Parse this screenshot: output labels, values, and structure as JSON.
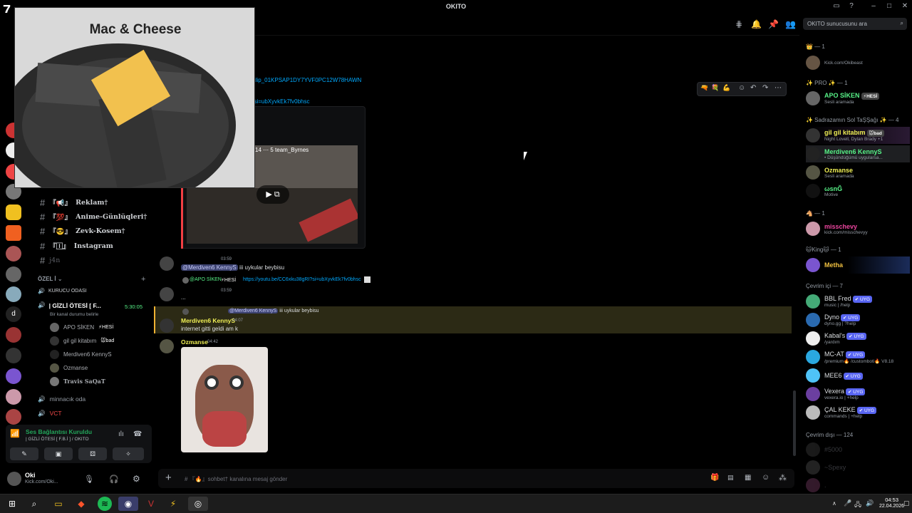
{
  "window": {
    "title": "OKITO",
    "corner_label": "7"
  },
  "header": {
    "search_placeholder": "OKITO sunucusunu ara"
  },
  "video_overlay": {
    "caption": "Mac & Cheese"
  },
  "channels": {
    "items": [
      {
        "label": "Reklam†",
        "prefix": "『📢』"
      },
      {
        "label": "Anime-Günlüqleri†",
        "prefix": "『💯』"
      },
      {
        "label": "Zevk-Kosem†",
        "prefix": "『😎』"
      },
      {
        "label": "Instagram",
        "prefix": "『🄸』"
      },
      {
        "label": "j4n",
        "prefix": ""
      }
    ],
    "category": "ÖZEL İ",
    "voice_channels": [
      {
        "label": "KURUCU ODASI"
      },
      {
        "label": "| GİZLİ ÖTESİ [ F...",
        "timer": "5:30:05",
        "status": "Bir kanal durumu belirle"
      }
    ],
    "voice_members": [
      "APO SİKEN",
      "gil gil kitabım",
      "Merdiven6 KennyS",
      "Ozmanse",
      "Travis SaQaT"
    ],
    "voice_member_tags": [
      "⚡HESİ",
      "🐭bad"
    ],
    "extra_channels": [
      "minnacık oda",
      "VCT"
    ]
  },
  "voice_panel": {
    "status": "Ses Bağlantısı Kuruldu",
    "channel": "| GİZLİ ÖTESİ [ F.B.İ ] / OKITO"
  },
  "user_panel": {
    "name": "Oki",
    "status": "Kick.com/Oki..."
  },
  "messages": {
    "clip_link": "ps/clip_01KPSAP1DY7YVF0PC12W78HAWN",
    "yt_link": "RI?si=ubXyvkEk7fv0bhsc",
    "embed_overlay": "14 ⋯ 5  team_Byrnes",
    "msg1": {
      "time": "03:59",
      "mention": "@Merdiven6 KennyS",
      "text": "iii uykular beybisu"
    },
    "msg2": {
      "reply_author": "@APO SİKEN",
      "reply_tag": "⚡HESİ",
      "reply_link": "https://youtu.be/CC6xku38gRI?si=ubXyvkEk7fv0bhsc",
      "time": "03:59",
      "text": "..."
    },
    "msg3": {
      "reply_mention": "@Merdiven6 KennyS",
      "reply_text": "iii uykular beybisu",
      "author": "Merdiven6 KennyS",
      "time": "04:07",
      "text": "internet gitti geldi am k"
    },
    "msg4": {
      "author": "Ozmanse",
      "time": "04:42"
    }
  },
  "composer": {
    "placeholder": "# 『🔥』sohbet† kanalına mesaj gönder"
  },
  "members": {
    "groups": [
      {
        "header": "👑 — 1",
        "members": [
          {
            "name": "",
            "sub": "Kick.com/Okibeast",
            "color": "#dbdee1"
          }
        ]
      },
      {
        "header": "✨ PRO ✨ — 1",
        "members": [
          {
            "name": "APO SİKEN",
            "tag": "⚡HESİ",
            "sub": "Sesli aramada",
            "color": "#57f287"
          }
        ]
      },
      {
        "header": "✨ Sadrazamın Sol TaŞŞağı ✨ — 4",
        "members": [
          {
            "name": "gil gil kitabım",
            "tag": "🐭bad",
            "sub": "Night Lovell, Dylan Brady +1",
            "color": "#f0f055"
          },
          {
            "name": "Merdiven6 KennyS",
            "sub": "• Düşündüğümü uygularsa...",
            "color": "#f0f055"
          },
          {
            "name": "Ozmanse",
            "sub": "Sesli aramada",
            "color": "#f0f055"
          },
          {
            "name": "ωsnĞ",
            "sub": "Motive",
            "color": "#f0f055"
          }
        ]
      },
      {
        "header": "🐴 — 1",
        "members": [
          {
            "name": "misschevy",
            "sub": "kick.com/misschevyy",
            "color": "#eb459e"
          }
        ]
      },
      {
        "header": "🐱King🐱 — 1",
        "members": [
          {
            "name": "Metha",
            "sub": "",
            "color": "#f0c040"
          }
        ]
      },
      {
        "header": "Çevrim içi — 7",
        "members": [
          {
            "name": "BBL Fred",
            "tag": "✔ UYG",
            "sub": "music | /help",
            "color": "#dbdee1"
          },
          {
            "name": "Dyno",
            "tag": "✔ UYG",
            "sub": "dyno.gg | ?help",
            "color": "#dbdee1"
          },
          {
            "name": "Kabal's",
            "tag": "✔ UYG",
            "sub": "/yardım",
            "color": "#dbdee1"
          },
          {
            "name": "MC-AT",
            "tag": "✔ UYG",
            "sub": "/premium🔥 /customboti🔥 V8.18",
            "color": "#dbdee1"
          },
          {
            "name": "MEE6",
            "tag": "✔ UYG",
            "sub": "",
            "color": "#dbdee1"
          },
          {
            "name": "Vexera",
            "tag": "✔ UYG",
            "sub": "vexera.io | +help",
            "color": "#dbdee1"
          },
          {
            "name": "ÇAL KEKE",
            "tag": "✔ UYG",
            "sub": "commands | +help",
            "color": "#dbdee1"
          }
        ]
      },
      {
        "header": "Çevrim dışı — 124",
        "members": [
          {
            "name": "#5000",
            "sub": "",
            "color": "#4e5058"
          },
          {
            "name": "~Spexy",
            "sub": "",
            "color": "#4e5058"
          },
          {
            "name": ".",
            "sub": "",
            "color": "#4e5058"
          }
        ]
      }
    ]
  },
  "taskbar": {
    "time": "04:53",
    "date": "22.04.2026"
  },
  "colors": {
    "accent": "#5865f2",
    "online": "#23a55a",
    "voice_green": "#57f287",
    "highlight_bg": "#2c2a15"
  }
}
